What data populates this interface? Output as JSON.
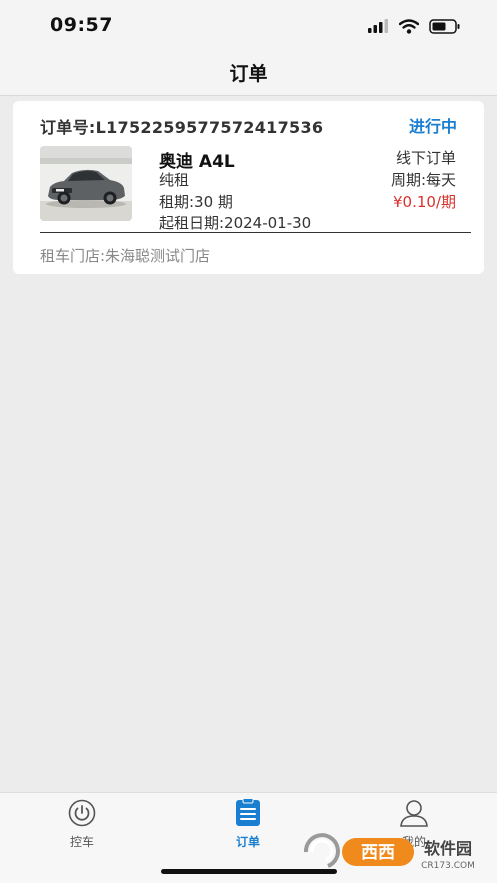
{
  "status_bar": {
    "time": "09:57"
  },
  "nav": {
    "title": "订单"
  },
  "order": {
    "order_no": "订单号:L1752259577572417536",
    "status": "进行中",
    "car_name": "奥迪 A4L",
    "rent_type": "纯租",
    "lease_term": "租期:30 期",
    "start_date": "起租日期:2024-01-30",
    "channel": "线下订单",
    "cycle": "周期:每天",
    "price": "¥0.10/期",
    "store": "租车门店:朱海聪测试门店"
  },
  "tabs": [
    {
      "label": "控车",
      "icon": "power-icon",
      "active": false
    },
    {
      "label": "订单",
      "icon": "order-list-icon",
      "active": true
    },
    {
      "label": "我的",
      "icon": "user-icon",
      "active": false
    }
  ],
  "colors": {
    "accent": "#1a7fd0",
    "price": "#d9322e",
    "background": "#ececec"
  }
}
